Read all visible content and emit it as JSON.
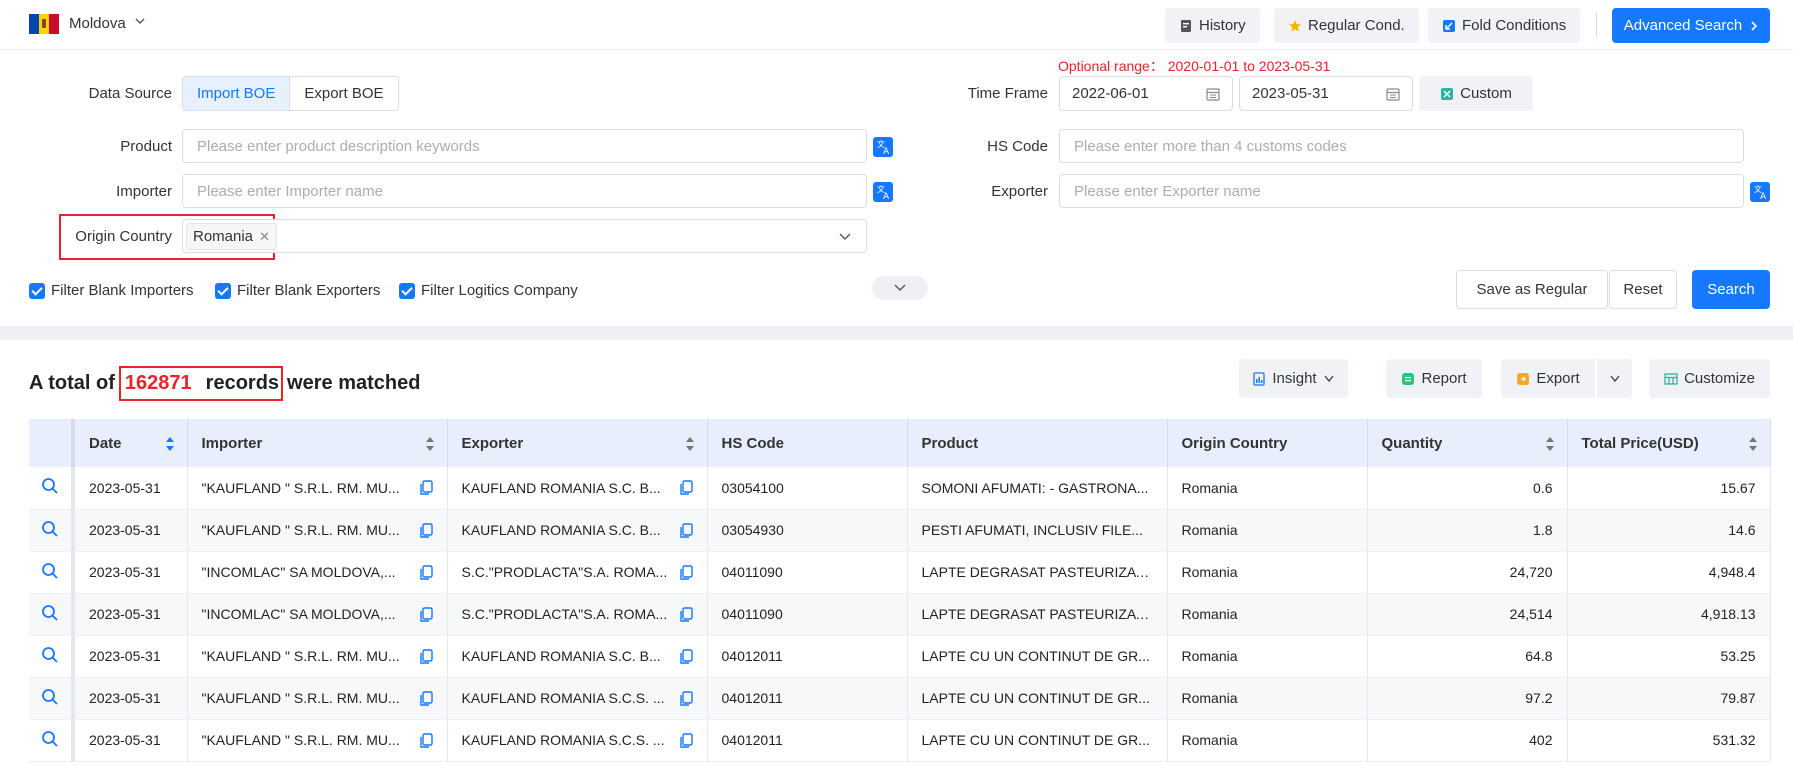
{
  "header": {
    "country": "Moldova",
    "history_label": "History",
    "regular_cond_label": "Regular Cond.",
    "fold_conditions_label": "Fold Conditions",
    "advanced_search_label": "Advanced Search"
  },
  "hint": {
    "prefix": "Optional range：",
    "range": " 2020-01-01 to 2023-05-31"
  },
  "form": {
    "data_source_label": "Data Source",
    "import_boe": "Import BOE",
    "export_boe": "Export BOE",
    "time_frame_label": "Time Frame",
    "date_from": "2022-06-01",
    "date_to": "2023-05-31",
    "custom_label": "Custom",
    "product_label": "Product",
    "product_placeholder": "Please enter product description keywords",
    "hs_code_label": "HS Code",
    "hs_code_placeholder": "Please enter more than 4 customs codes",
    "importer_label": "Importer",
    "importer_placeholder": "Please enter Importer name",
    "exporter_label": "Exporter",
    "exporter_placeholder": "Please enter Exporter name",
    "origin_country_label": "Origin Country",
    "origin_country_tag": "Romania",
    "filters": [
      "Filter Blank Importers",
      "Filter Blank Exporters",
      "Filter Logitics Company"
    ],
    "save_regular_label": "Save as Regular",
    "reset_label": "Reset",
    "search_label": "Search"
  },
  "results": {
    "prefix": "A total of",
    "count": "162871",
    "records_word": "records",
    "suffix": "were matched",
    "insight_label": "Insight",
    "report_label": "Report",
    "export_label": "Export",
    "customize_label": "Customize"
  },
  "table": {
    "columns": [
      "Date",
      "Importer",
      "Exporter",
      "HS Code",
      "Product",
      "Origin Country",
      "Quantity",
      "Total Price(USD)"
    ],
    "rows": [
      {
        "date": "2023-05-31",
        "importer": "\"KAUFLAND \" S.R.L. RM. MU...",
        "exporter": "KAUFLAND ROMANIA S.C. B...",
        "hs": "03054100",
        "product": "SOMONI AFUMATI: - GASTRONA...",
        "origin": "Romania",
        "qty": "0.6",
        "price": "15.67"
      },
      {
        "date": "2023-05-31",
        "importer": "\"KAUFLAND \" S.R.L. RM. MU...",
        "exporter": "KAUFLAND ROMANIA S.C. B...",
        "hs": "03054930",
        "product": "PESTI AFUMATI, INCLUSIV FILE...",
        "origin": "Romania",
        "qty": "1.8",
        "price": "14.6"
      },
      {
        "date": "2023-05-31",
        "importer": "\"INCOMLAC\" SA MOLDOVA,...",
        "exporter": "S.C.\"PRODLACTA\"S.A. ROMA...",
        "hs": "04011090",
        "product": "LAPTE DEGRASAT PASTEURIZAT...",
        "origin": "Romania",
        "qty": "24,720",
        "price": "4,948.4"
      },
      {
        "date": "2023-05-31",
        "importer": "\"INCOMLAC\" SA MOLDOVA,...",
        "exporter": "S.C.\"PRODLACTA\"S.A. ROMA...",
        "hs": "04011090",
        "product": "LAPTE DEGRASAT PASTEURIZAT...",
        "origin": "Romania",
        "qty": "24,514",
        "price": "4,918.13"
      },
      {
        "date": "2023-05-31",
        "importer": "\"KAUFLAND \" S.R.L. RM. MU...",
        "exporter": "KAUFLAND ROMANIA S.C. B...",
        "hs": "04012011",
        "product": "LAPTE CU UN CONTINUT DE GR...",
        "origin": "Romania",
        "qty": "64.8",
        "price": "53.25"
      },
      {
        "date": "2023-05-31",
        "importer": "\"KAUFLAND \" S.R.L. RM. MU...",
        "exporter": "KAUFLAND ROMANIA S.C.S. ...",
        "hs": "04012011",
        "product": "LAPTE CU UN CONTINUT DE GR...",
        "origin": "Romania",
        "qty": "97.2",
        "price": "79.87"
      },
      {
        "date": "2023-05-31",
        "importer": "\"KAUFLAND \" S.R.L. RM. MU...",
        "exporter": "KAUFLAND ROMANIA S.C.S. ...",
        "hs": "04012011",
        "product": "LAPTE CU UN CONTINUT DE GR...",
        "origin": "Romania",
        "qty": "402",
        "price": "531.32"
      }
    ]
  },
  "colors": {
    "accent": "#1677ff",
    "highlight": "#e8232a",
    "header_bg": "#e8eefb"
  },
  "icons": [
    "moldova-flag-icon",
    "chevron-down-icon",
    "history-icon",
    "star-icon",
    "fold-icon",
    "chevron-right-icon",
    "calendar-icon",
    "custom-icon",
    "translate-icon",
    "close-icon",
    "insight-icon",
    "report-icon",
    "export-icon",
    "customize-icon",
    "sort-icon",
    "magnifier-icon",
    "copy-icon"
  ]
}
